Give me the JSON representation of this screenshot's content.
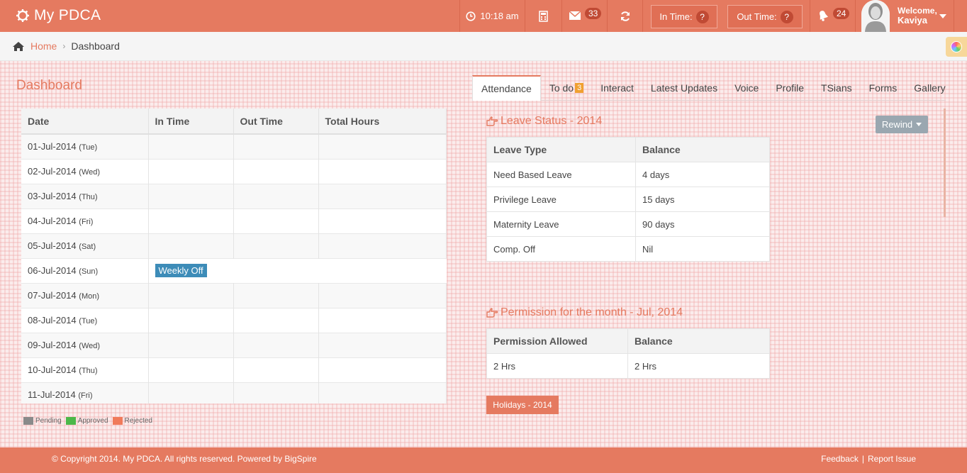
{
  "app": {
    "brand": "My PDCA"
  },
  "topbar": {
    "clock_time": "10:18 am",
    "mail_count": "33",
    "in_time_label": "In Time:",
    "in_time_value": "?",
    "out_time_label": "Out Time:",
    "out_time_value": "?",
    "notification_count": "24",
    "welcome": "Welcome,",
    "user_name": "Kaviya"
  },
  "breadcrumb": {
    "home": "Home",
    "current": "Dashboard"
  },
  "page": {
    "title": "Dashboard"
  },
  "attendance": {
    "columns": [
      "Date",
      "In Time",
      "Out Time",
      "Total Hours"
    ],
    "rows": [
      {
        "date": "01-Jul-2014",
        "day": "(Tue)"
      },
      {
        "date": "02-Jul-2014",
        "day": "(Wed)"
      },
      {
        "date": "03-Jul-2014",
        "day": "(Thu)"
      },
      {
        "date": "04-Jul-2014",
        "day": "(Fri)"
      },
      {
        "date": "05-Jul-2014",
        "day": "(Sat)"
      },
      {
        "date": "06-Jul-2014",
        "day": "(Sun)",
        "note": "Weekly Off"
      },
      {
        "date": "07-Jul-2014",
        "day": "(Mon)"
      },
      {
        "date": "08-Jul-2014",
        "day": "(Tue)"
      },
      {
        "date": "09-Jul-2014",
        "day": "(Wed)"
      },
      {
        "date": "10-Jul-2014",
        "day": "(Thu)"
      },
      {
        "date": "11-Jul-2014",
        "day": "(Fri)"
      }
    ]
  },
  "legend": [
    {
      "label": "Pending",
      "color": "#8a8a8a"
    },
    {
      "label": "Approved",
      "color": "#4cb849"
    },
    {
      "label": "Rejected",
      "color": "#f07a5a"
    }
  ],
  "tabs": [
    {
      "label": "Attendance",
      "active": true
    },
    {
      "label": "To do",
      "badge": "3"
    },
    {
      "label": "Interact"
    },
    {
      "label": "Latest Updates"
    },
    {
      "label": "Voice"
    },
    {
      "label": "Profile"
    },
    {
      "label": "TSians"
    },
    {
      "label": "Forms"
    },
    {
      "label": "Gallery"
    }
  ],
  "leave_status": {
    "title": "Leave Status - 2014",
    "rewind_label": "Rewind",
    "columns": [
      "Leave Type",
      "Balance"
    ],
    "rows": [
      [
        "Need Based Leave",
        "4 days"
      ],
      [
        "Privilege Leave",
        "15 days"
      ],
      [
        "Maternity Leave",
        "90 days"
      ],
      [
        "Comp. Off",
        "Nil"
      ]
    ]
  },
  "permission": {
    "title": "Permission for the month - Jul, 2014",
    "columns": [
      "Permission Allowed",
      "Balance"
    ],
    "rows": [
      [
        "2 Hrs",
        "2 Hrs"
      ]
    ]
  },
  "holidays": {
    "label": "Holidays - 2014"
  },
  "footer": {
    "copyright": "© Copyright 2014. My PDCA. All rights reserved. Powered by BigSpire",
    "feedback": "Feedback",
    "separator": "|",
    "report_issue": "Report Issue"
  },
  "colors": {
    "accent": "#e57a60",
    "info_badge": "#3d8cb8",
    "todo_badge": "#f0a030"
  }
}
